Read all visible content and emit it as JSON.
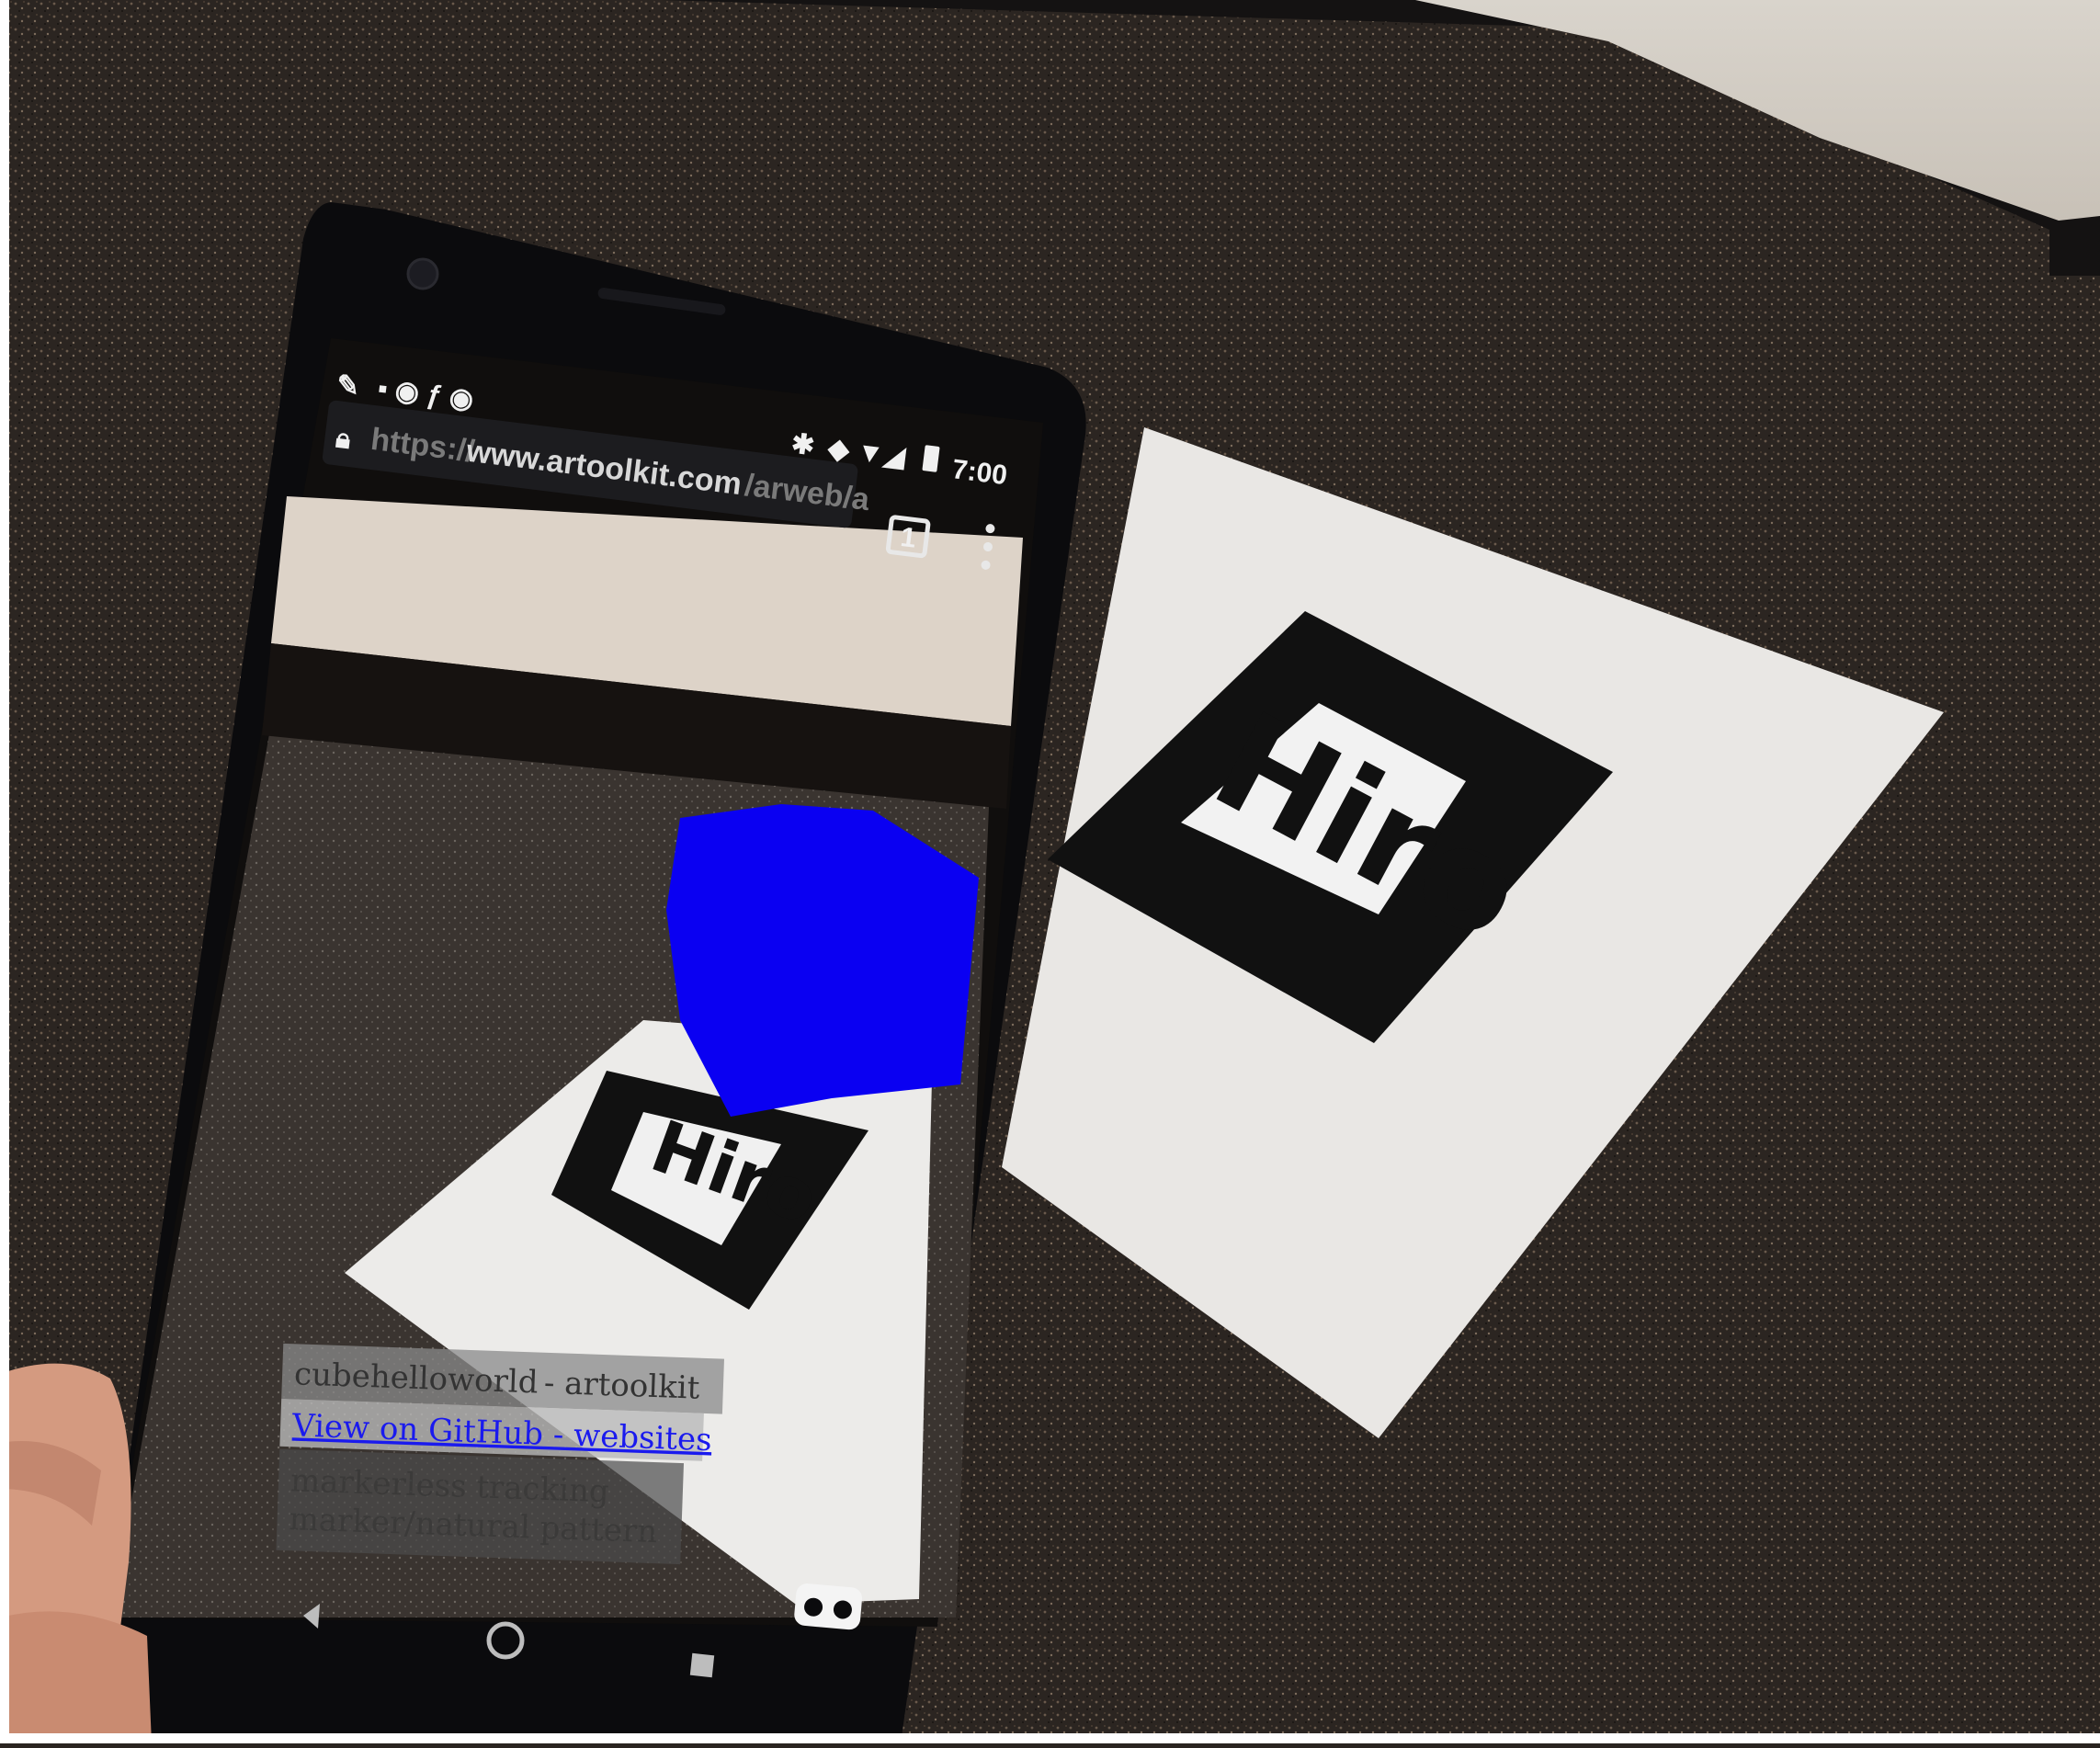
{
  "browser": {
    "url_prefix": "https://",
    "url_domain": "www.artoolkit.com",
    "url_path": "/arweb/a",
    "tab_count": "1"
  },
  "status_bar": {
    "time": "7:00"
  },
  "markers": {
    "physical_label": "Hiro",
    "onscreen_label": "Hiro"
  },
  "page_overlay": {
    "line1_prefix": "cubehelloworld",
    "line1_suffix": " - artoolkit",
    "link_text": "View on GitHub - websites",
    "line3": "markerless tracking",
    "line4": "marker/natural pattern"
  },
  "colors": {
    "cube": "#0a00f2",
    "carpet": "#2a2420",
    "paper": "#e9e7e4",
    "phone_body": "#0b0b0d"
  },
  "icons": [
    "lock-icon",
    "tabs-icon",
    "overflow-menu-icon",
    "back-nav-icon",
    "home-nav-icon",
    "recents-nav-icon",
    "vr-cardboard-icon",
    "wrench-icon",
    "bluetooth-icon",
    "wifi-icon",
    "battery-icon"
  ]
}
